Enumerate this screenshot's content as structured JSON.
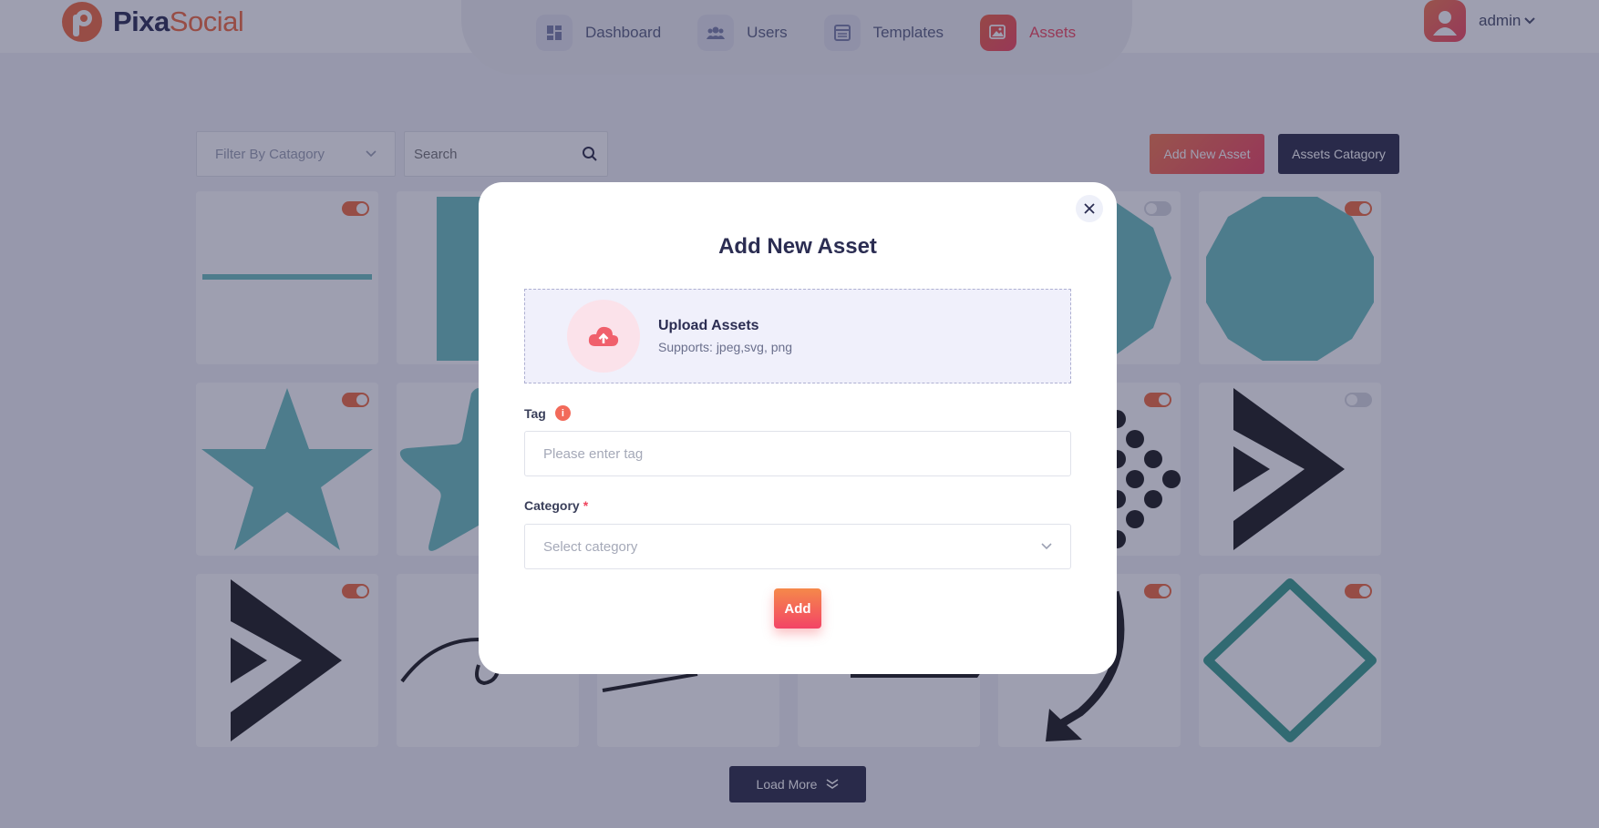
{
  "brand": {
    "name_part1": "Pixa",
    "name_part2": "Social"
  },
  "nav": {
    "items": [
      {
        "label": "Dashboard",
        "icon": "dashboard-icon",
        "active": false
      },
      {
        "label": "Users",
        "icon": "users-icon",
        "active": false
      },
      {
        "label": "Templates",
        "icon": "templates-icon",
        "active": false
      },
      {
        "label": "Assets",
        "icon": "assets-icon",
        "active": true
      }
    ]
  },
  "user": {
    "name": "admin"
  },
  "toolbar": {
    "filter_placeholder": "Filter By Catagory",
    "search_placeholder": "Search",
    "add_asset_label": "Add New Asset",
    "assets_category_label": "Assets Catagory"
  },
  "assets": [
    {
      "shape": "line",
      "enabled": true
    },
    {
      "shape": "rectangle",
      "enabled": true
    },
    {
      "shape": "hidden",
      "enabled": true
    },
    {
      "shape": "hidden",
      "enabled": true
    },
    {
      "shape": "octagon",
      "enabled": false
    },
    {
      "shape": "decagon",
      "enabled": true
    },
    {
      "shape": "star",
      "enabled": true
    },
    {
      "shape": "rounded-star",
      "enabled": true
    },
    {
      "shape": "hidden",
      "enabled": true
    },
    {
      "shape": "hidden",
      "enabled": true
    },
    {
      "shape": "dots",
      "enabled": true
    },
    {
      "shape": "chevron",
      "enabled": false
    },
    {
      "shape": "chevron",
      "enabled": true
    },
    {
      "shape": "curve",
      "enabled": true
    },
    {
      "shape": "line-stroke",
      "enabled": true
    },
    {
      "shape": "rect-stroke",
      "enabled": true
    },
    {
      "shape": "curved-arrow",
      "enabled": true
    },
    {
      "shape": "diamond",
      "enabled": true
    }
  ],
  "load_more_label": "Load More",
  "colors": {
    "accent": "#f3455e",
    "dark": "#2b2b45",
    "teal": "#6cbfbd",
    "teal_dark": "#3a9f8f"
  },
  "modal": {
    "title": "Add New Asset",
    "upload_title": "Upload Assets",
    "upload_sub": "Supports: jpeg,svg, png",
    "tag_label": "Tag",
    "tag_placeholder": "Please enter tag",
    "category_label": "Category",
    "required_mark": "*",
    "category_placeholder": "Select category",
    "add_label": "Add"
  }
}
